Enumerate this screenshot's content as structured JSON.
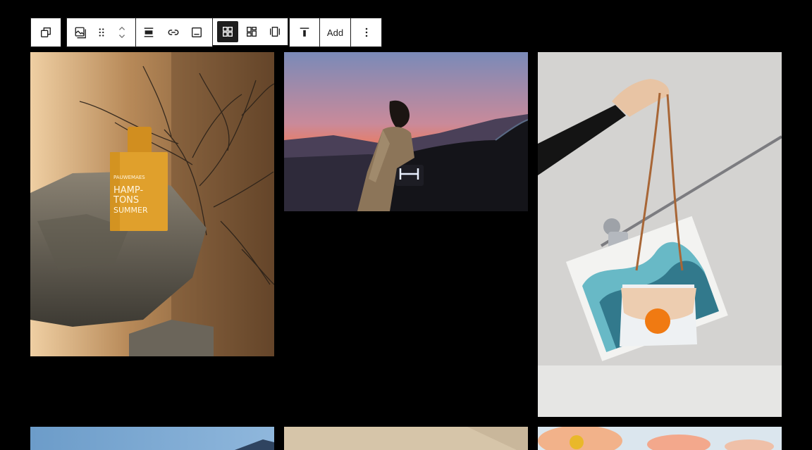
{
  "toolbar": {
    "add_label": "Add"
  },
  "icons": {
    "transform": "duplicate-squares-icon",
    "block_type": "gallery-icon",
    "drag": "drag-handle-icon",
    "move": "chevron-up-down-icon",
    "align": "align-icon",
    "link": "link-icon",
    "caption": "caption-icon",
    "layout_grid": "grid-layout-icon",
    "layout_mosaic": "mosaic-layout-icon",
    "layout_carousel": "carousel-layout-icon",
    "vertical_align": "align-top-icon",
    "more": "more-vertical-icon"
  },
  "product_label": {
    "brand": "PAUWEMAES",
    "line1": "HAMP-",
    "line2": "TONS",
    "line3": "SUMMER"
  },
  "colors": {
    "page_background": "#000000",
    "toolbar_background": "#ffffff",
    "toolbar_border": "#1e1e1e",
    "active_button": "#1e1e1e"
  }
}
